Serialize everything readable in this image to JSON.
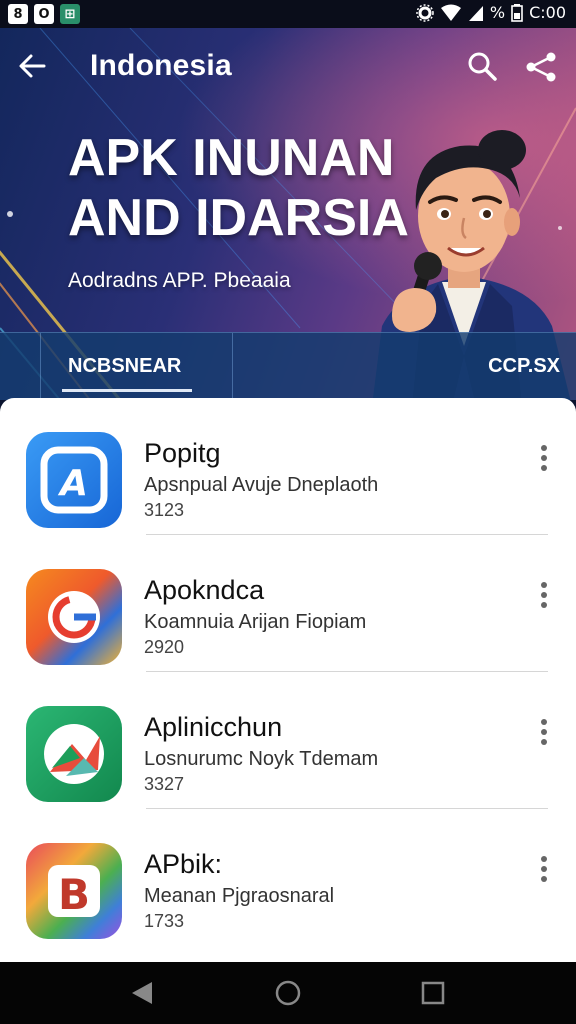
{
  "status_bar": {
    "left_icons": [
      "8",
      "O",
      "⊞"
    ],
    "battery_percent": "%",
    "time": "C:00"
  },
  "header": {
    "title": "Indonesia",
    "headline_line1": "APK INUNAN",
    "headline_line2": "AND IDARSIA",
    "subtitle": "Aodradns APP. Pbeaaia"
  },
  "tabs": {
    "left": "NCBSNEAR",
    "right": "CCP.SX"
  },
  "apps": [
    {
      "name": "Popitg",
      "description": "Apsnpual Avuje Dneplaoth",
      "number": "3123",
      "icon": "blue-app-icon"
    },
    {
      "name": "Apokndca",
      "description": "Koamnuia Arijan Fiopiam",
      "number": "2920",
      "icon": "orange-swirl-app-icon"
    },
    {
      "name": "Aplinicchun",
      "description": "Losnurumc Noyk Tdemam",
      "number": "3327",
      "icon": "green-app-icon"
    },
    {
      "name": "APbik:",
      "description": "Meanan Pjgraosnaral",
      "number": "1733",
      "icon": "rainbow-b-app-icon"
    }
  ],
  "colors": {
    "hero_start": "#13275c",
    "hero_end": "#b2567f",
    "tabbar": "#143c6e",
    "card_bg": "#ffffff",
    "navbar": "#050505"
  }
}
